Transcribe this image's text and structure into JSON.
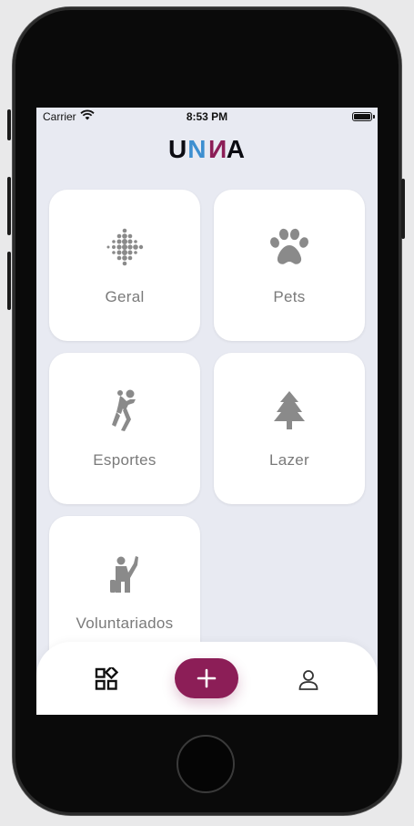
{
  "status_bar": {
    "carrier": "Carrier",
    "time": "8:53 PM"
  },
  "logo": {
    "letters": [
      "U",
      "N",
      "N",
      "A"
    ],
    "colors": [
      "#0b0b12",
      "#3d8fd0",
      "#8c1e57",
      "#0b0b12"
    ]
  },
  "categories": [
    {
      "label": "Geral",
      "icon": "dot-grid-icon"
    },
    {
      "label": "Pets",
      "icon": "paw-icon"
    },
    {
      "label": "Esportes",
      "icon": "sports-player-icon"
    },
    {
      "label": "Lazer",
      "icon": "tree-icon"
    },
    {
      "label": "Voluntariados",
      "icon": "volunteer-icon"
    }
  ],
  "bottom_nav": {
    "items": [
      {
        "icon": "categories-grid-icon"
      },
      {
        "icon": "plus-icon"
      },
      {
        "icon": "profile-icon"
      }
    ],
    "accent": "#8c1e57"
  },
  "theme": {
    "background": "#e8eaf2",
    "card": "#ffffff",
    "label_color": "#7a7a7a"
  }
}
